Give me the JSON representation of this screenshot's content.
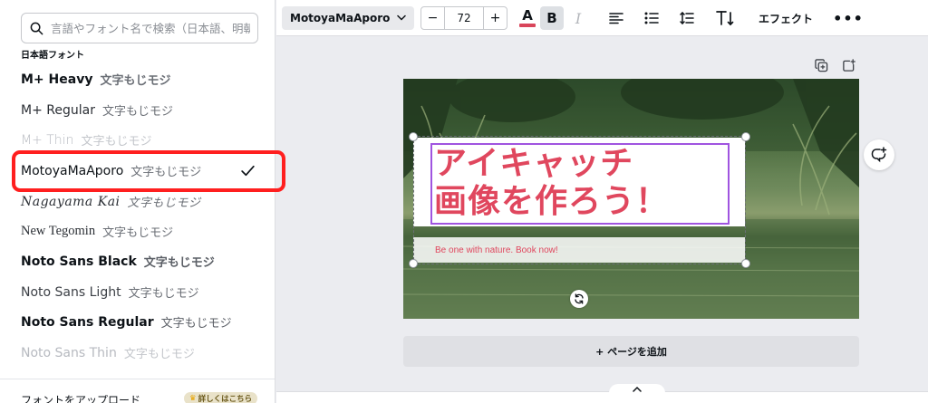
{
  "font_panel": {
    "search_placeholder": "言語やフォント名で検索（日本語、明朝",
    "section_label": "日本語フォント",
    "fonts": [
      {
        "name": "M+ Heavy",
        "sample": "文字もじモジ"
      },
      {
        "name": "M+ Regular",
        "sample": "文字もじモジ"
      },
      {
        "name": "M+ Thin",
        "sample": "文字もじモジ"
      },
      {
        "name": "MotoyaMaAporo",
        "sample": "文字もじモジ",
        "selected": true
      },
      {
        "name": "Nagayama Kai",
        "sample": "文字もじモジ"
      },
      {
        "name": "New Tegomin",
        "sample": "文字もじモジ"
      },
      {
        "name": "Noto Sans Black",
        "sample": "文字もじモジ"
      },
      {
        "name": "Noto Sans Light",
        "sample": "文字もじモジ"
      },
      {
        "name": "Noto Sans Regular",
        "sample": "文字もじモジ"
      },
      {
        "name": "Noto Sans Thin",
        "sample": "文字もじモジ"
      }
    ],
    "upload_label": "フォントをアップロード",
    "pro_badge": "詳しくはこちら"
  },
  "toolbar": {
    "font_name": "MotoyaMaAporo",
    "minus": "−",
    "font_size": "72",
    "plus": "+",
    "text_color_glyph": "A",
    "text_color": "#d9455b",
    "bold": "B",
    "italic": "I",
    "effect_label": "エフェクト",
    "more": "•••"
  },
  "canvas": {
    "headline_line1": "アイキャッチ",
    "headline_line2": "画像を作ろう！",
    "subline": "Be one with nature. Book now!",
    "accent_color": "#e0475e",
    "selection_color": "#a054e0"
  },
  "add_page_label": "+ ページを追加"
}
